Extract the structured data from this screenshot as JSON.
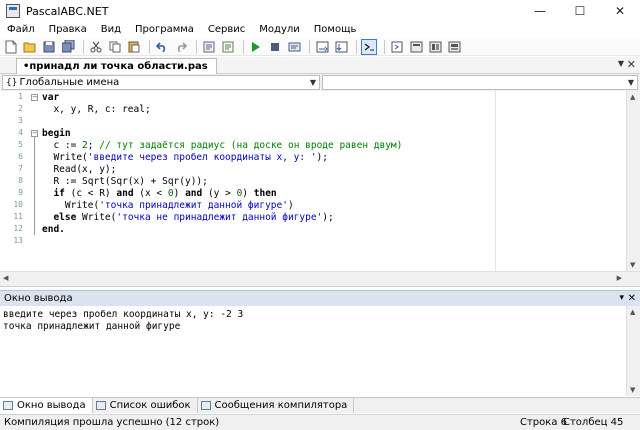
{
  "window": {
    "title": "PascalABC.NET"
  },
  "menu": [
    "Файл",
    "Правка",
    "Вид",
    "Программа",
    "Сервис",
    "Модули",
    "Помощь"
  ],
  "document_tab": {
    "label": "•принадл ли точка области.pas"
  },
  "scope": {
    "left": "Глобальные имена",
    "right": ""
  },
  "editor": {
    "line_numbers": [
      "1",
      "2",
      "3",
      "4",
      "5",
      "6",
      "7",
      "8",
      "9",
      "10",
      "11",
      "12",
      "13"
    ],
    "lines": [
      [
        {
          "t": "var",
          "c": "kw"
        }
      ],
      [
        {
          "t": "  x, y, R, c: real;",
          "c": "fn"
        }
      ],
      [
        {
          "t": "",
          "c": "fn"
        }
      ],
      [
        {
          "t": "begin",
          "c": "kw"
        }
      ],
      [
        {
          "t": "  c := ",
          "c": "fn"
        },
        {
          "t": "2",
          "c": "num"
        },
        {
          "t": "; ",
          "c": "fn"
        },
        {
          "t": "// тут задаётся радиус (на доске он вроде равен двум)",
          "c": "cmt"
        }
      ],
      [
        {
          "t": "  Write(",
          "c": "fn"
        },
        {
          "t": "'введите через пробел координаты x, y: '",
          "c": "str"
        },
        {
          "t": ");",
          "c": "fn"
        }
      ],
      [
        {
          "t": "  Read(x, y);",
          "c": "fn"
        }
      ],
      [
        {
          "t": "  R := Sqrt(Sqr(x) + Sqr(y));",
          "c": "fn"
        }
      ],
      [
        {
          "t": "  if",
          "c": "kw"
        },
        {
          "t": " (c < R) ",
          "c": "fn"
        },
        {
          "t": "and",
          "c": "kw"
        },
        {
          "t": " (x < ",
          "c": "fn"
        },
        {
          "t": "0",
          "c": "num"
        },
        {
          "t": ") ",
          "c": "fn"
        },
        {
          "t": "and",
          "c": "kw"
        },
        {
          "t": " (y > ",
          "c": "fn"
        },
        {
          "t": "0",
          "c": "num"
        },
        {
          "t": ") ",
          "c": "fn"
        },
        {
          "t": "then",
          "c": "kw"
        }
      ],
      [
        {
          "t": "    Write(",
          "c": "fn"
        },
        {
          "t": "'точка принадлежит данной фигуре'",
          "c": "str"
        },
        {
          "t": ")",
          "c": "fn"
        }
      ],
      [
        {
          "t": "  else",
          "c": "kw"
        },
        {
          "t": " Write(",
          "c": "fn"
        },
        {
          "t": "'точка не принадлежит данной фигуре'",
          "c": "str"
        },
        {
          "t": ");",
          "c": "fn"
        }
      ],
      [
        {
          "t": "end.",
          "c": "kw"
        }
      ],
      [
        {
          "t": "",
          "c": "fn"
        }
      ]
    ]
  },
  "output": {
    "header": "Окно вывода",
    "lines": [
      "введите через пробел координаты x, y: -2 3",
      "точка принадлежит данной фигуре"
    ]
  },
  "bottom_tabs": [
    "Окно вывода",
    "Список ошибок",
    "Сообщения компилятора"
  ],
  "status": {
    "message": "Компиляция прошла успешно (12 строк)",
    "line_label": "Строка  6",
    "col_label": "Столбец  45"
  },
  "icons": {
    "toolbar": [
      "new-file-icon",
      "open-icon",
      "save-icon",
      "save-all-icon",
      "cut-icon",
      "copy-icon",
      "paste-icon",
      "undo-icon",
      "redo-icon",
      "comment-icon",
      "uncomment-icon",
      "run-icon",
      "stop-icon",
      "compile-icon",
      "step-over-icon",
      "step-into-icon",
      "output-window-icon",
      "form-designer-icon",
      "help-icon",
      "module-1-icon",
      "module-2-icon"
    ]
  }
}
